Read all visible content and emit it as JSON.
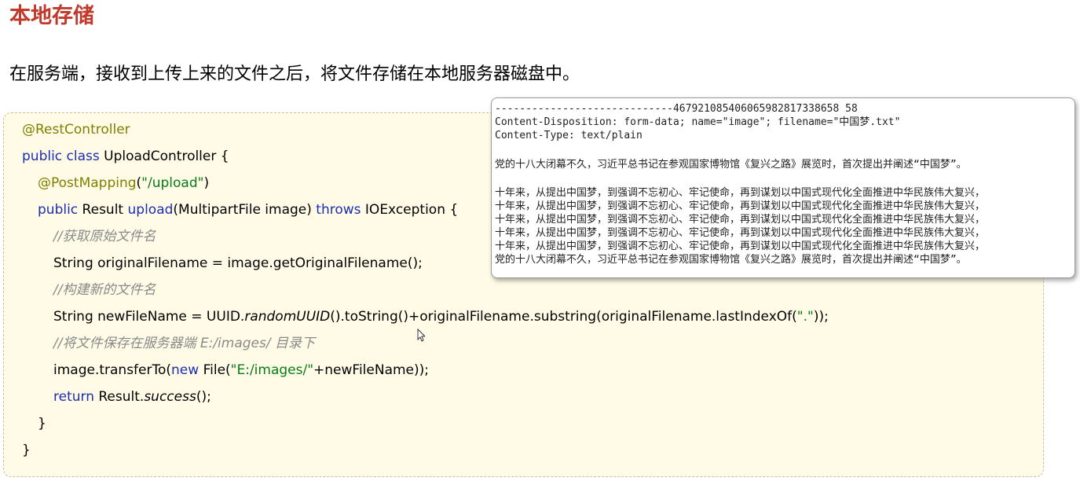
{
  "page": {
    "title": "本地存储",
    "intro": "在服务端，接收到上传上来的文件之后，将文件存储在本地服务器磁盘中。"
  },
  "code": {
    "l1": "@RestController",
    "l2_kw": "public class",
    "l2_rest": " UploadController {",
    "l3_ann": "@PostMapping",
    "l3_p1": "(",
    "l3_str": "\"/upload\"",
    "l3_p2": ")",
    "l4_kw1": "public",
    "l4_t1": " Result ",
    "l4_m": "upload",
    "l4_t2": "(MultipartFile image) ",
    "l4_kw2": "throws",
    "l4_t3": " IOException {",
    "l5": "//获取原始文件名",
    "l6": "String originalFilename = image.getOriginalFilename();",
    "l7": "//构建新的文件名",
    "l8_a": "String newFileName = UUID.",
    "l8_it": "randomUUID",
    "l8_b": "().toString()+originalFilename.substring(originalFilename.lastIndexOf(",
    "l8_str": "\".\"",
    "l8_c": "));",
    "l9": "//将文件保存在服务器端 E:/images/ 目录下",
    "l10_a": "image.transferTo(",
    "l10_kw": "new",
    "l10_b": " File(",
    "l10_str": "\"E:/images/\"",
    "l10_c": "+newFileName));",
    "l11_kw": "return",
    "l11_a": " Result.",
    "l11_it": "success",
    "l11_b": "();",
    "l12": "}",
    "l13": "}"
  },
  "popup": {
    "lines": [
      "-----------------------------467921085406065982817338658 58",
      "Content-Disposition: form-data; name=\"image\"; filename=\"中国梦.txt\"",
      "Content-Type: text/plain",
      "",
      "党的十八大闭幕不久，习近平总书记在参观国家博物馆《复兴之路》展览时，首次提出并阐述“中国梦”。",
      "",
      "十年来，从提出中国梦，到强调不忘初心、牢记使命，再到谋划以中国式现代化全面推进中华民族伟大复兴，",
      "十年来，从提出中国梦，到强调不忘初心、牢记使命，再到谋划以中国式现代化全面推进中华民族伟大复兴，",
      "十年来，从提出中国梦，到强调不忘初心、牢记使命，再到谋划以中国式现代化全面推进中华民族伟大复兴，",
      "十年来，从提出中国梦，到强调不忘初心、牢记使命，再到谋划以中国式现代化全面推进中华民族伟大复兴，",
      "十年来，从提出中国梦，到强调不忘初心、牢记使命，再到谋划以中国式现代化全面推进中华民族伟大复兴，",
      "党的十八大闭幕不久，习近平总书记在参观国家博物馆《复兴之路》展览时，首次提出并阐述“中国梦”。"
    ]
  }
}
